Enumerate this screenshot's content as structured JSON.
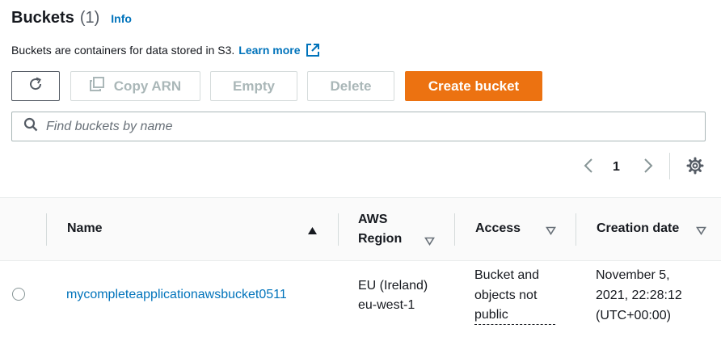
{
  "header": {
    "title": "Buckets",
    "count": "(1)",
    "info_label": "Info",
    "description": "Buckets are containers for data stored in S3.",
    "learn_more": "Learn more"
  },
  "toolbar": {
    "copy_arn": "Copy ARN",
    "empty": "Empty",
    "delete": "Delete",
    "create_bucket": "Create bucket"
  },
  "search": {
    "placeholder": "Find buckets by name",
    "value": ""
  },
  "pagination": {
    "current_page": "1"
  },
  "table": {
    "columns": {
      "name": "Name",
      "region_line1": "AWS",
      "region_line2": "Region",
      "access": "Access",
      "creation_date": "Creation date"
    },
    "rows": [
      {
        "name": "mycompleteapplicationawsbucket0511",
        "region_line1": "EU (Ireland)",
        "region_line2": "eu-west-1",
        "access_line1": "Bucket and",
        "access_line2": "objects not",
        "access_line3": "public",
        "date_line1": "November 5,",
        "date_line2": "2021, 22:28:12",
        "date_line3": "(UTC+00:00)"
      }
    ]
  },
  "colors": {
    "primary_button": "#ec7211",
    "link": "#0073bb",
    "text": "#16191f",
    "disabled": "#aab7b8"
  },
  "icons": {
    "refresh": "refresh-icon",
    "copy": "copy-icon",
    "external_link": "external-link-icon",
    "search": "search-icon",
    "prev": "chevron-left-icon",
    "next": "chevron-right-icon",
    "settings": "gear-icon",
    "sort_asc": "caret-up-icon",
    "sort_desc": "caret-down-icon"
  }
}
